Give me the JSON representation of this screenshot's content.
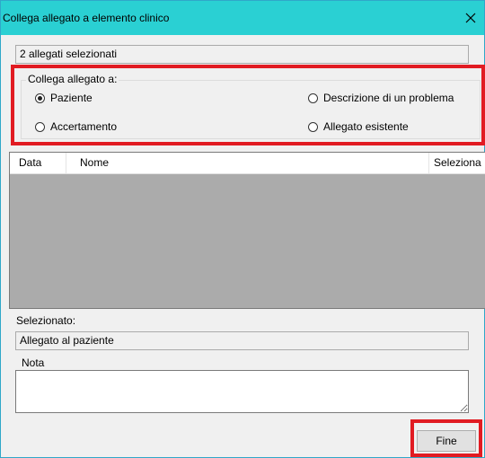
{
  "window": {
    "title": "Collega allegato a elemento clinico",
    "close_glyph": "✕",
    "colors": {
      "titlebar": "#2ad0d3",
      "highlight": "#e11b22",
      "grid_empty": "#ababab"
    }
  },
  "selection_count_text": "2 allegati selezionati",
  "link_group": {
    "legend": "Collega allegato a:",
    "options": [
      {
        "label": "Paziente",
        "selected": true
      },
      {
        "label": "Descrizione di un problema",
        "selected": false
      },
      {
        "label": "Accertamento",
        "selected": false
      },
      {
        "label": "Allegato esistente",
        "selected": false
      }
    ]
  },
  "table": {
    "columns": [
      "Data",
      "Nome",
      "Seleziona"
    ],
    "rows": []
  },
  "selected": {
    "label": "Selezionato:",
    "value": "Allegato al paziente"
  },
  "note": {
    "label": "Nota",
    "value": ""
  },
  "buttons": {
    "finish": "Fine"
  }
}
